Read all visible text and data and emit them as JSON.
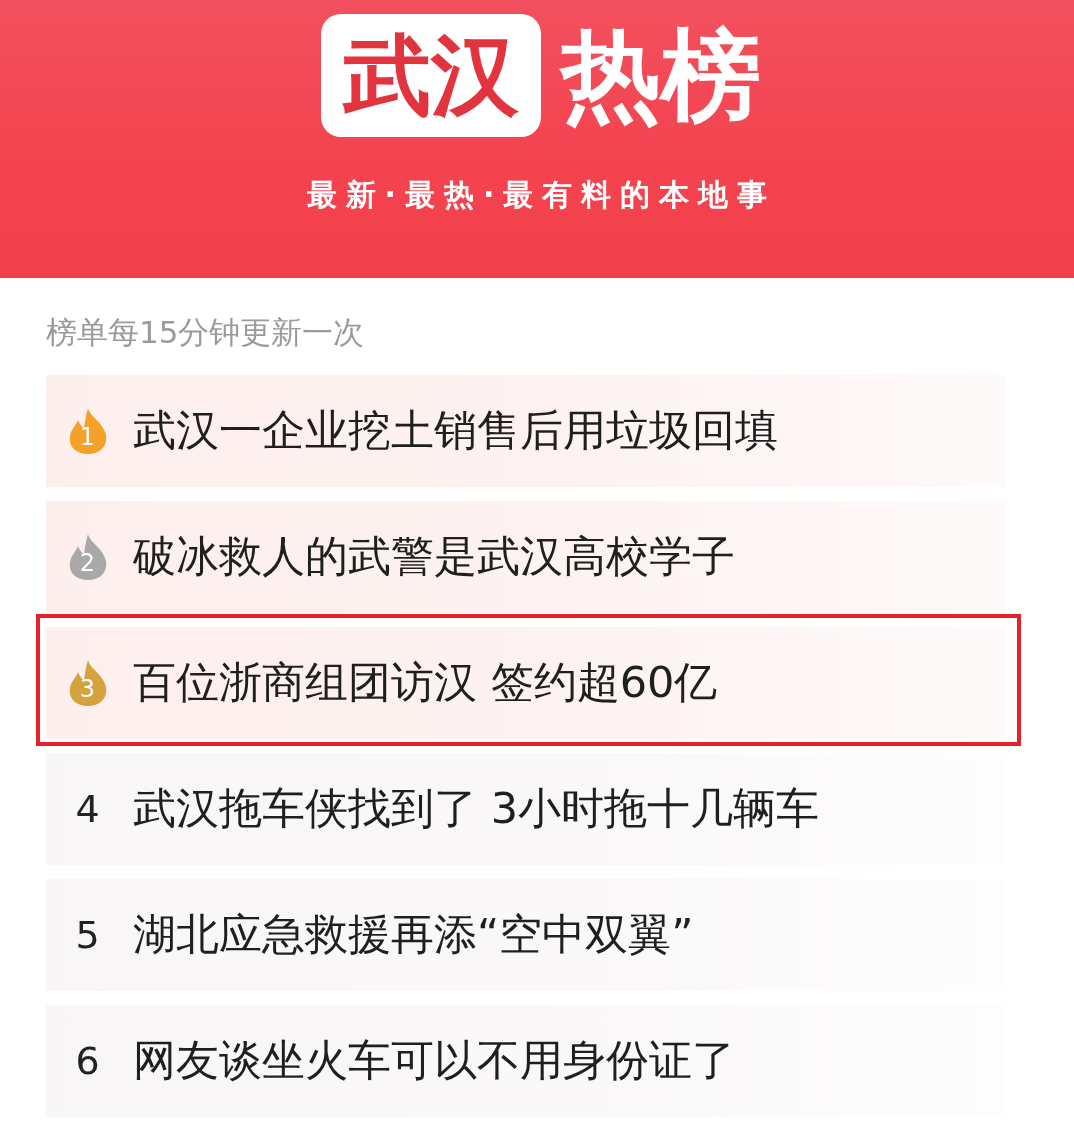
{
  "header": {
    "logo_text": "武汉",
    "title": "热榜",
    "subtitle": "最新·最热·最有料的本地事"
  },
  "update_note": "榜单每15分钟更新一次",
  "hot_list": [
    {
      "rank": "1",
      "kind": "flame",
      "color": "#f5a02a",
      "title": "武汉一企业挖土销售后用垃圾回填",
      "highlighted": false
    },
    {
      "rank": "2",
      "kind": "flame",
      "color": "#a9a9a9",
      "title": "破冰救人的武警是武汉高校学子",
      "highlighted": false
    },
    {
      "rank": "3",
      "kind": "flame",
      "color": "#d6a23e",
      "title": "百位浙商组团访汉 签约超60亿",
      "highlighted": true
    },
    {
      "rank": "4",
      "kind": "plain",
      "title": "武汉拖车侠找到了 3小时拖十几辆车",
      "highlighted": false
    },
    {
      "rank": "5",
      "kind": "plain",
      "title": "湖北应急救援再添“空中双翼”",
      "highlighted": false
    },
    {
      "rank": "6",
      "kind": "plain",
      "title": "网友谈坐火车可以不用身份证了",
      "highlighted": false
    }
  ]
}
